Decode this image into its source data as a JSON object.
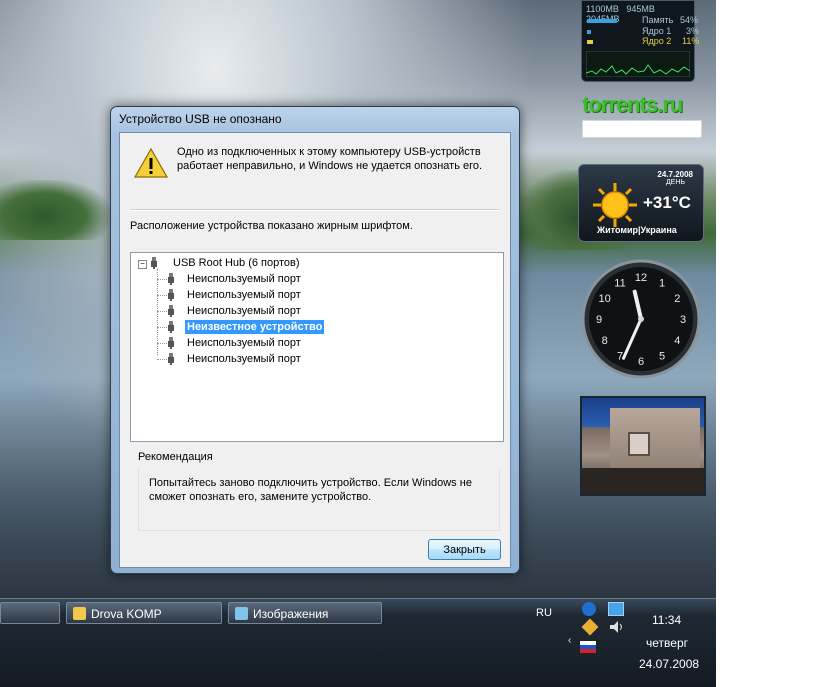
{
  "dialog": {
    "title": "Устройство USB не опознано",
    "message": "Одно из подключенных к этому компьютеру USB-устройств работает неправильно, и Windows не удается опознать его.",
    "location_label": "Расположение устройства показано жирным шрифтом.",
    "tree": {
      "root": "USB Root Hub (6 портов)",
      "ports": [
        {
          "label": "Неиспользуемый порт",
          "selected": false
        },
        {
          "label": "Неиспользуемый порт",
          "selected": false
        },
        {
          "label": "Неиспользуемый порт",
          "selected": false
        },
        {
          "label": "Неизвестное устройство",
          "selected": true
        },
        {
          "label": "Неиспользуемый порт",
          "selected": false
        },
        {
          "label": "Неиспользуемый порт",
          "selected": false
        }
      ]
    },
    "recommendation_title": "Рекомендация",
    "recommendation_text": "Попытайтесь заново подключить устройство. Если Windows не сможет опознать его, замените устройство.",
    "close_label": "Закрыть"
  },
  "gadgets": {
    "cpu": {
      "mem_values": [
        "1100MB",
        "945MB",
        "2045MB"
      ],
      "memory_label": "Память",
      "memory_pct": "54%",
      "core1_label": "Ядро 1",
      "core1_pct": "3%",
      "core2_label": "Ядро 2",
      "core2_pct": "11%"
    },
    "torrents_logo": "torrents.ru",
    "weather": {
      "date": "24.7.2008",
      "day": "ДЕНЬ",
      "temp": "+31°C",
      "city": "Житомир|Украина"
    },
    "clock": {
      "hour": 11,
      "minute": 34
    }
  },
  "taskbar": {
    "buttons": [
      "Drova KOMP",
      "Изображения"
    ],
    "language": "RU",
    "time": "11:34",
    "weekday": "четверг",
    "date": "24.07.2008"
  },
  "colors": {
    "selection": "#3399ff",
    "title_bar": "#a7c3df",
    "taskbar": "#1f2933"
  }
}
